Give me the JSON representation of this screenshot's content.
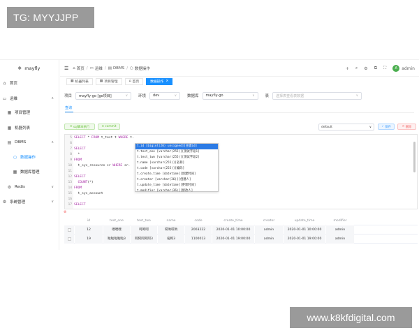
{
  "watermark_top": "TG: MYYJJPP",
  "watermark_bottom": "www.k8kfdigital.com",
  "brand": "mayfly",
  "sidebar": {
    "items": [
      {
        "label": "首页",
        "icon": "home-icon"
      },
      {
        "label": "运维",
        "icon": "monitor-icon"
      },
      {
        "label": "项目管理",
        "icon": "grid-icon"
      },
      {
        "label": "机器列表",
        "icon": "grid-icon"
      },
      {
        "label": "DBMS",
        "icon": "database-icon"
      },
      {
        "label": "数据操作",
        "icon": "circle-icon"
      },
      {
        "label": "数据库管理",
        "icon": "grid-icon"
      },
      {
        "label": "Redis",
        "icon": "gear-icon"
      },
      {
        "label": "系统管理",
        "icon": "gear-icon"
      }
    ]
  },
  "breadcrumb": [
    "首页",
    "运维",
    "DBMS",
    "数据操作"
  ],
  "header": {
    "user": "admin",
    "avatar_letter": "A"
  },
  "tabs": [
    {
      "label": "机器列表"
    },
    {
      "label": "项目管理"
    },
    {
      "label": "首页"
    },
    {
      "label": "数据操作",
      "active": true
    }
  ],
  "filters": {
    "project_label": "项目",
    "project_value": "mayfly-go [go项目]",
    "env_label": "环境",
    "env_value": "dev",
    "db_label": "数据库",
    "db_value": "mayfly-go",
    "table_label": "表",
    "table_placeholder": "选择表查看表数据"
  },
  "subtab": "查询",
  "toolbar": {
    "run_label": "sql脚本执行",
    "commit_label": "commit",
    "theme_value": "default",
    "save_label": "保存",
    "delete_label": "删除"
  },
  "editor_lines": [
    {
      "n": "5",
      "parts": [
        [
          "kw",
          "SELECT"
        ],
        [
          "tx",
          " * "
        ],
        [
          "kw",
          "FROM"
        ],
        [
          "tx",
          " t_test t "
        ],
        [
          "kw",
          "WHERE"
        ],
        [
          "tx",
          " t."
        ]
      ]
    },
    {
      "n": "6",
      "parts": [
        [
          "tx",
          ""
        ]
      ]
    },
    {
      "n": "7",
      "parts": [
        [
          "kw",
          "SELECT"
        ]
      ]
    },
    {
      "n": "8",
      "parts": [
        [
          "tx",
          "  *"
        ]
      ]
    },
    {
      "n": "9",
      "parts": [
        [
          "kw",
          "FROM"
        ]
      ]
    },
    {
      "n": "10",
      "parts": [
        [
          "tx",
          "  t_sys_resource sr "
        ],
        [
          "kw",
          "WHERE"
        ],
        [
          "tx",
          " sr."
        ]
      ]
    },
    {
      "n": "11",
      "parts": [
        [
          "tx",
          ""
        ]
      ]
    },
    {
      "n": "12",
      "parts": [
        [
          "kw",
          "SELECT"
        ]
      ]
    },
    {
      "n": "13",
      "parts": [
        [
          "fn",
          "  COUNT"
        ],
        [
          "tx",
          "(*)"
        ]
      ]
    },
    {
      "n": "14",
      "parts": [
        [
          "kw",
          "FROM"
        ]
      ]
    },
    {
      "n": "15",
      "parts": [
        [
          "tx",
          "  t_sys_account"
        ]
      ]
    },
    {
      "n": "16",
      "parts": [
        [
          "tx",
          ""
        ]
      ]
    },
    {
      "n": "17",
      "parts": [
        [
          "kw",
          "SELECT"
        ]
      ]
    }
  ],
  "autocomplete": [
    "t.id  [bigint(20) unsigned][主键id]",
    "t.text_one  [varchar(255)][测试字段1]",
    "t.text_two  [varchar(255)][测试字段2]",
    "t.name  [varchar(255)][名称]",
    "t.code  [varchar(255)][编码]",
    "t.create_time  [datetime][创建时间]",
    "t.creator  [varchar(36)][创建人]",
    "t.update_time  [datetime][更新时间]",
    "t.modifier  [varchar(36)][修改人]"
  ],
  "table": {
    "columns": [
      "id",
      "text_one",
      "text_two",
      "name",
      "code",
      "create_time",
      "creator",
      "update_time",
      "modifier"
    ],
    "rows": [
      [
        "12",
        "嘿嘿嘿",
        "呵呵呵",
        "哎哟哎哟",
        "2003222",
        "2020-01-01 10:00:00",
        "admin",
        "2020-01-01 10:00:00",
        "admin"
      ],
      [
        "19",
        "啦啦啦啦啦3",
        "阿阿阿阿阿3",
        "名称3",
        "1100013",
        "2020-01-01 19:00:00",
        "admin",
        "2020-01-01 19:00:00",
        "admin"
      ]
    ]
  },
  "colors": {
    "accent": "#1890ff",
    "selection": "#2c7be5",
    "keyword": "#a626a4"
  }
}
